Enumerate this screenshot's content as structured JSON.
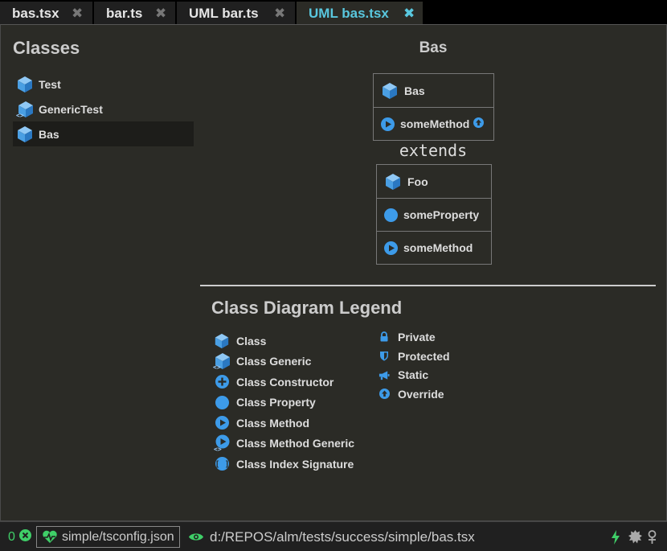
{
  "tabs": [
    {
      "label": "bas.tsx",
      "close": "✖"
    },
    {
      "label": "bar.ts",
      "close": "✖"
    },
    {
      "label": "UML bar.ts",
      "close": "✖"
    },
    {
      "label": "UML bas.tsx",
      "close": "✖"
    }
  ],
  "classes_panel": {
    "title": "Classes",
    "items": [
      {
        "label": "Test",
        "icon": "class-icon"
      },
      {
        "label": "GenericTest",
        "icon": "class-generic-icon"
      },
      {
        "label": "Bas",
        "icon": "class-icon"
      }
    ]
  },
  "diagram": {
    "title": "Bas",
    "class_box": {
      "name": "Bas",
      "members": [
        {
          "label": "someMethod",
          "icon": "method-icon",
          "badge": "override-icon"
        }
      ]
    },
    "extends_label": "extends",
    "parent_box": {
      "name": "Foo",
      "members": [
        {
          "label": "someProperty",
          "icon": "property-icon"
        },
        {
          "label": "someMethod",
          "icon": "method-icon"
        }
      ]
    }
  },
  "legend": {
    "title": "Class Diagram Legend",
    "left": [
      {
        "label": "Class",
        "icon": "class-icon"
      },
      {
        "label": "Class Generic",
        "icon": "class-generic-icon"
      },
      {
        "label": "Class Constructor",
        "icon": "constructor-icon"
      },
      {
        "label": "Class Property",
        "icon": "property-icon"
      },
      {
        "label": "Class Method",
        "icon": "method-icon"
      },
      {
        "label": "Class Method Generic",
        "icon": "method-generic-icon"
      },
      {
        "label": "Class Index Signature",
        "icon": "index-signature-icon"
      }
    ],
    "right": [
      {
        "label": "Private",
        "icon": "lock-icon"
      },
      {
        "label": "Protected",
        "icon": "shield-icon"
      },
      {
        "label": "Static",
        "icon": "bullhorn-icon"
      },
      {
        "label": "Override",
        "icon": "arrow-up-circle-icon"
      }
    ]
  },
  "statusbar": {
    "error_count": "0",
    "tsconfig": "simple/tsconfig.json",
    "file_path": "d:/REPOS/alm/tests/success/simple/bas.tsx"
  },
  "colors": {
    "accent": "#59c7de",
    "icon_blue": "#3d9be9",
    "success_green": "#3fcf68",
    "panel_bg": "#2b2b26"
  }
}
